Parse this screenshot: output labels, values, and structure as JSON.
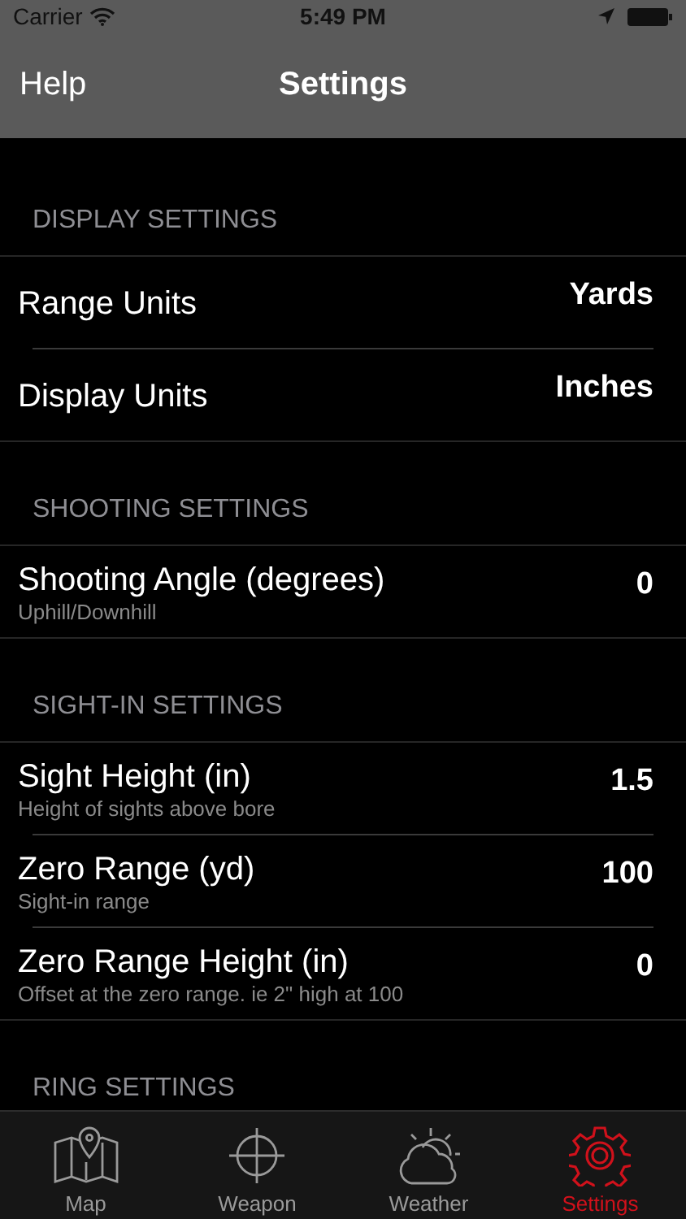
{
  "status_bar": {
    "carrier": "Carrier",
    "time": "5:49 PM"
  },
  "nav_bar": {
    "left_button": "Help",
    "title": "Settings"
  },
  "sections": [
    {
      "title": "DISPLAY SETTINGS",
      "rows": [
        {
          "label": "Range Units",
          "value": "Yards"
        },
        {
          "label": "Display Units",
          "value": "Inches"
        }
      ]
    },
    {
      "title": "SHOOTING SETTINGS",
      "rows": [
        {
          "label": "Shooting Angle (degrees)",
          "subtitle": "Uphill/Downhill",
          "value": "0"
        }
      ]
    },
    {
      "title": "SIGHT-IN SETTINGS",
      "rows": [
        {
          "label": "Sight Height (in)",
          "subtitle": "Height of sights above bore",
          "value": "1.5"
        },
        {
          "label": "Zero Range (yd)",
          "subtitle": "Sight-in range",
          "value": "100"
        },
        {
          "label": "Zero Range Height (in)",
          "subtitle": "Offset at the zero range. ie 2\" high at 100",
          "value": "0"
        }
      ]
    },
    {
      "title": "RING SETTINGS"
    }
  ],
  "tabs": [
    {
      "label": "Map",
      "selected": false
    },
    {
      "label": "Weapon",
      "selected": false
    },
    {
      "label": "Weather",
      "selected": false
    },
    {
      "label": "Settings",
      "selected": true
    }
  ]
}
